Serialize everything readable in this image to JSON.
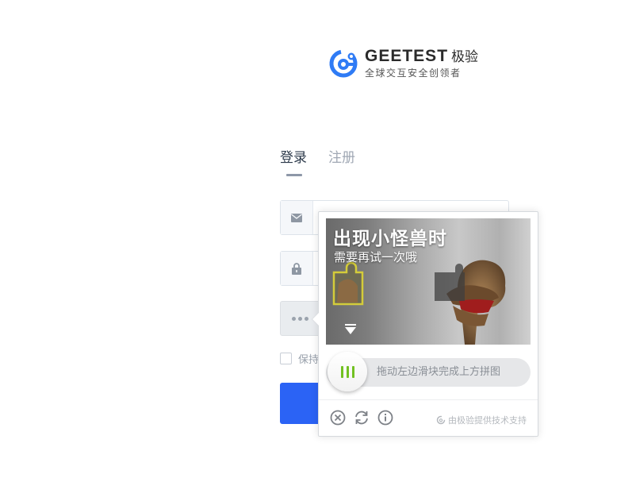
{
  "brand": {
    "name": "GEETEST",
    "name_cn": "极验",
    "tagline": "全球交互安全创领者"
  },
  "tabs": [
    {
      "label": "登录"
    },
    {
      "label": "注册"
    }
  ],
  "form": {
    "remember_label": "保持"
  },
  "captcha": {
    "image_title": "出现小怪兽时",
    "image_subtitle": "需要再试一次哦",
    "slider_hint": "拖动左边滑块完成上方拼图",
    "credit": "由极验提供技术支持"
  },
  "colors": {
    "accent": "#2b63f5",
    "slider_bars": "#72c122",
    "logo": "#2f7bf5"
  },
  "icons": [
    "email-icon",
    "lock-icon",
    "close-icon",
    "refresh-icon",
    "info-icon",
    "geetest-small-icon"
  ]
}
